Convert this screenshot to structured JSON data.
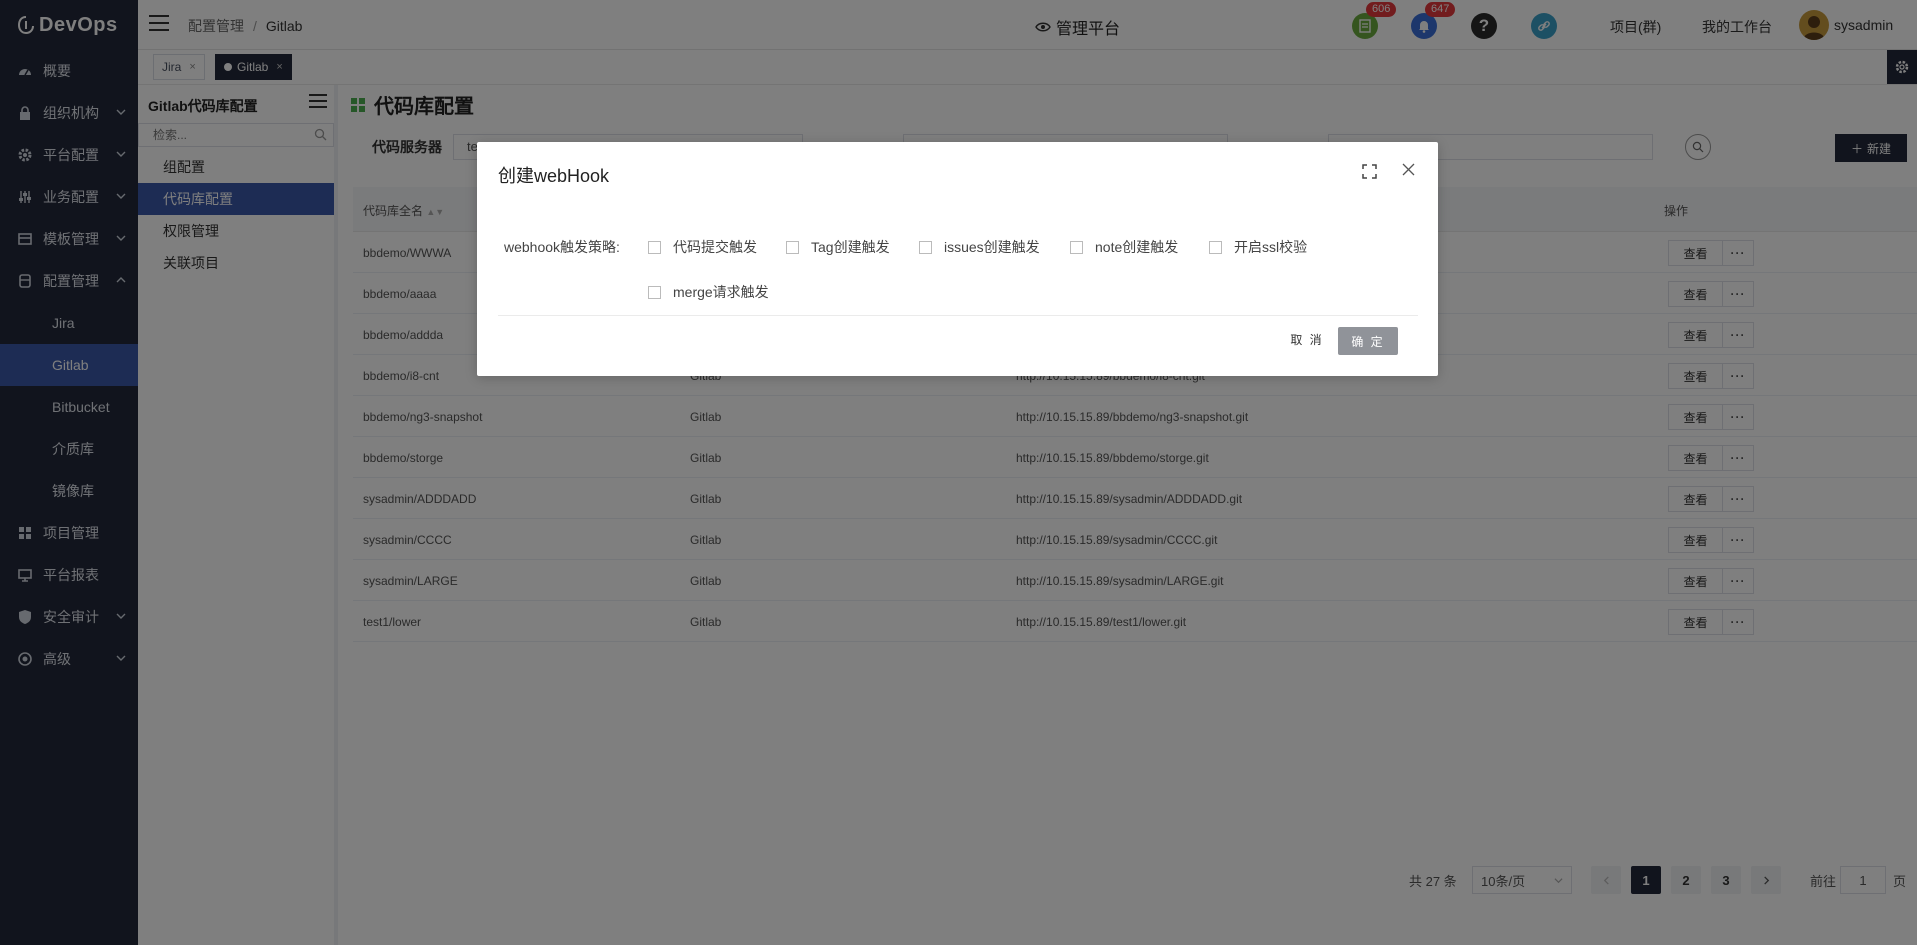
{
  "app": {
    "name": "DevOps"
  },
  "sidebar": {
    "items": [
      {
        "label": "概要"
      },
      {
        "label": "组织机构"
      },
      {
        "label": "平台配置"
      },
      {
        "label": "业务配置"
      },
      {
        "label": "模板管理"
      },
      {
        "label": "配置管理"
      },
      {
        "label": "Jira"
      },
      {
        "label": "Gitlab"
      },
      {
        "label": "Bitbucket"
      },
      {
        "label": "介质库"
      },
      {
        "label": "镜像库"
      },
      {
        "label": "项目管理"
      },
      {
        "label": "平台报表"
      },
      {
        "label": "安全审计"
      },
      {
        "label": "高级"
      }
    ]
  },
  "header": {
    "breadcrumb": [
      "配置管理",
      "Gitlab"
    ],
    "breadcrumb_sep": "/",
    "title": "管理平台",
    "badge_1": "606",
    "badge_2": "647",
    "link_project": "项目(群)",
    "link_workbench": "我的工作台",
    "username": "sysadmin"
  },
  "tags": [
    {
      "label": "Jira",
      "close": "×"
    },
    {
      "label": "Gitlab",
      "close": "×"
    }
  ],
  "left_panel": {
    "title": "Gitlab代码库配置",
    "search_placeholder": "检索...",
    "items": [
      "组配置",
      "代码库配置",
      "权限管理",
      "关联项目"
    ]
  },
  "main": {
    "title": "代码库配置",
    "filter_label": "代码服务器",
    "filter_value": "te",
    "new_button": "新建",
    "columns": [
      "代码库全名",
      "操作"
    ],
    "rows": [
      {
        "name": "bbdemo/WWWA",
        "type": "",
        "url": ""
      },
      {
        "name": "bbdemo/aaaa",
        "type": "",
        "url": ""
      },
      {
        "name": "bbdemo/addda",
        "type": "",
        "url": ""
      },
      {
        "name": "bbdemo/i8-cnt",
        "type": "Gitlab",
        "url": "http://10.15.15.89/bbdemo/i8-cnt.git"
      },
      {
        "name": "bbdemo/ng3-snapshot",
        "type": "Gitlab",
        "url": "http://10.15.15.89/bbdemo/ng3-snapshot.git"
      },
      {
        "name": "bbdemo/storge",
        "type": "Gitlab",
        "url": "http://10.15.15.89/bbdemo/storge.git"
      },
      {
        "name": "sysadmin/ADDDADD",
        "type": "Gitlab",
        "url": "http://10.15.15.89/sysadmin/ADDDADD.git"
      },
      {
        "name": "sysadmin/CCCC",
        "type": "Gitlab",
        "url": "http://10.15.15.89/sysadmin/CCCC.git"
      },
      {
        "name": "sysadmin/LARGE",
        "type": "Gitlab",
        "url": "http://10.15.15.89/sysadmin/LARGE.git"
      },
      {
        "name": "test1/lower",
        "type": "Gitlab",
        "url": "http://10.15.15.89/test1/lower.git"
      }
    ],
    "view_label": "查看",
    "more_label": "···"
  },
  "pagination": {
    "total": "共 27 条",
    "page_size": "10条/页",
    "pages": [
      "1",
      "2",
      "3"
    ],
    "current": "1",
    "goto_prefix": "前往",
    "goto_value": "1",
    "goto_suffix": "页"
  },
  "dialog": {
    "title": "创建webHook",
    "label": "webhook触发策略:",
    "options": [
      "代码提交触发",
      "Tag创建触发",
      "issues创建触发",
      "note创建触发",
      "开启ssl校验",
      "merge请求触发"
    ],
    "cancel": "取 消",
    "ok": "确 定"
  },
  "colors": {
    "sidebar_bg": "#23293a",
    "accent": "#3a58a8",
    "badge": "#e4393c"
  }
}
